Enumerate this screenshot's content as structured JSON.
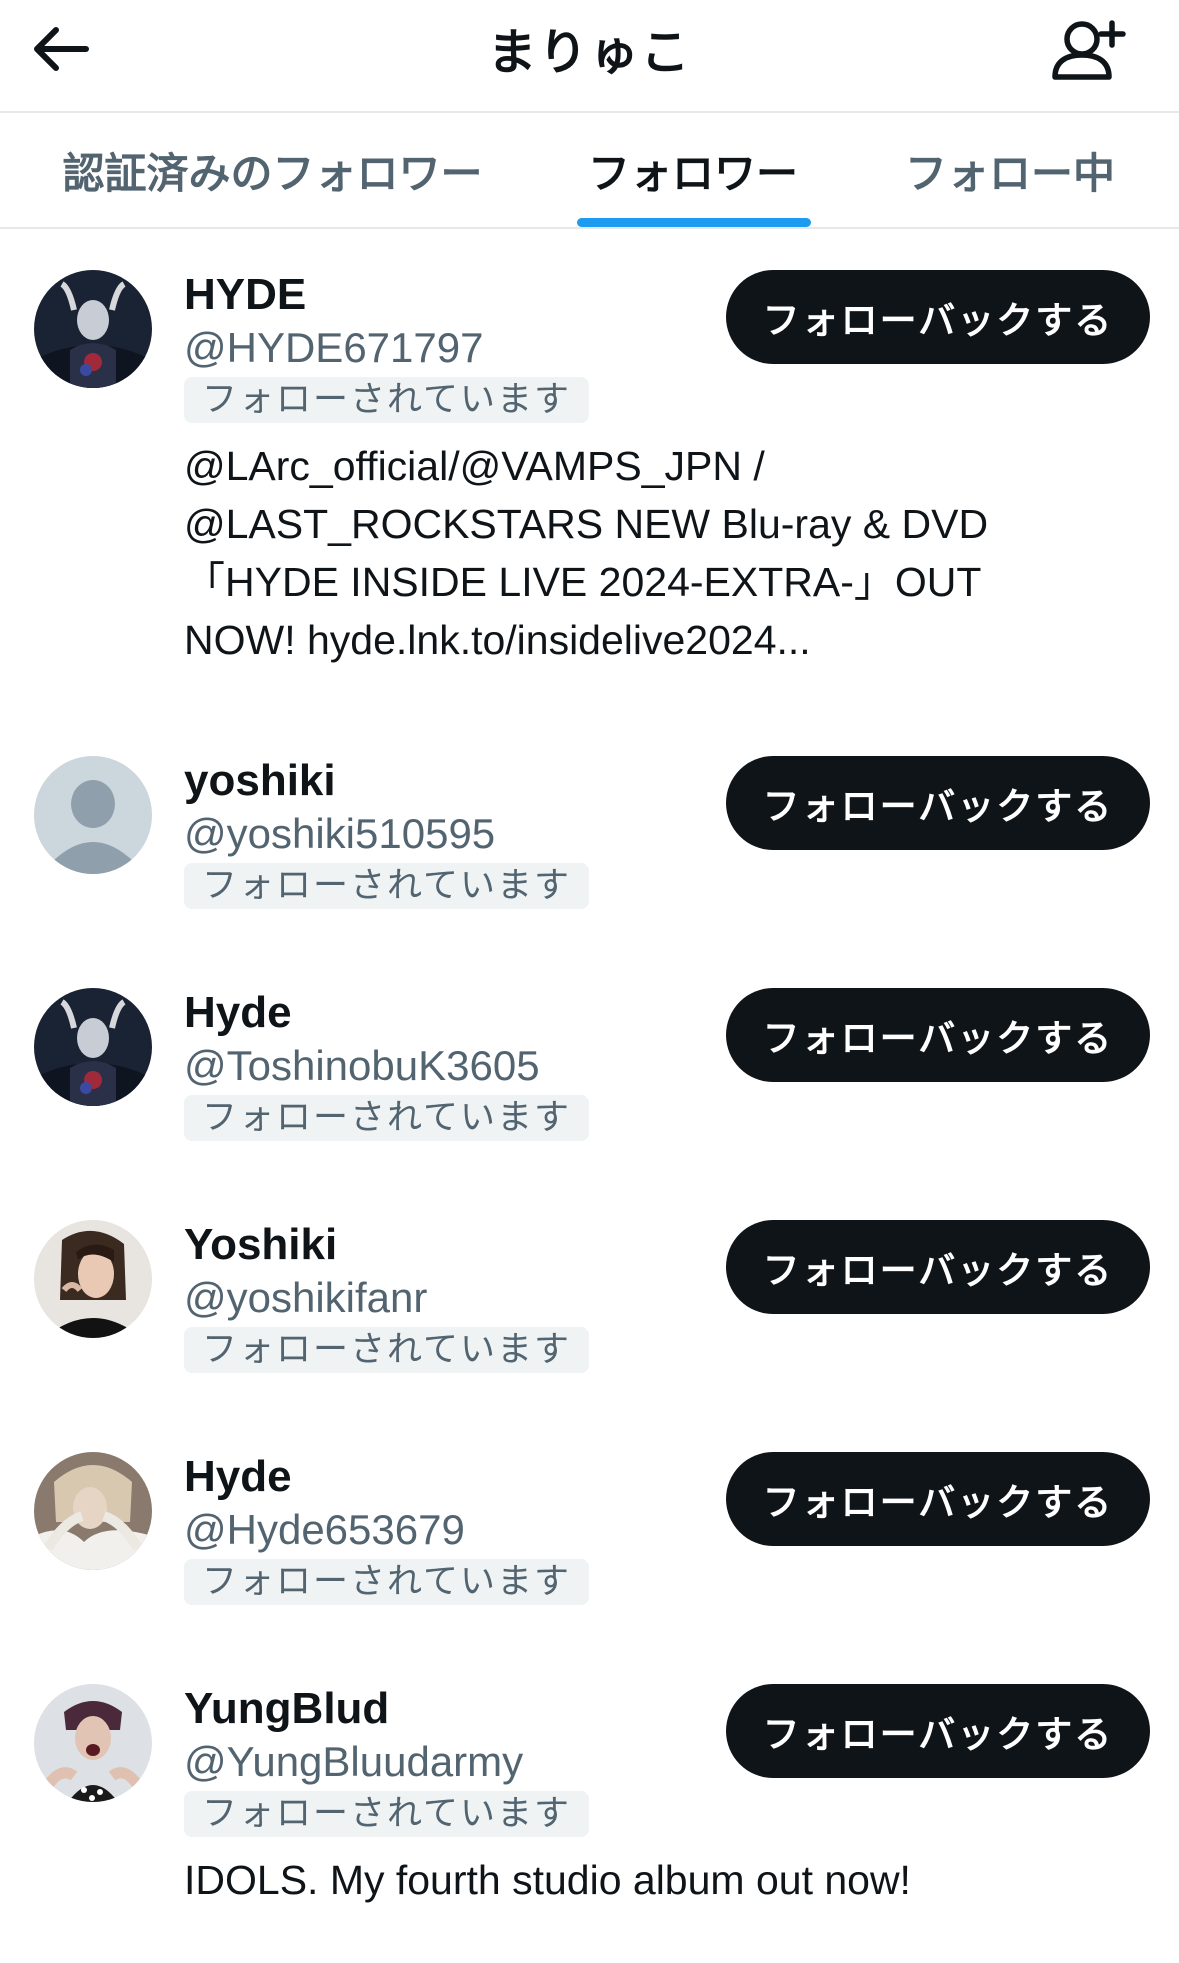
{
  "header": {
    "title": "まりゅこ",
    "back_icon": "arrow-left-icon",
    "add_user_icon": "add-user-icon"
  },
  "tabs": [
    {
      "label": "認証済みのフォロワー",
      "active": false
    },
    {
      "label": "フォロワー",
      "active": true
    },
    {
      "label": "フォロー中",
      "active": false
    }
  ],
  "colors": {
    "accent": "#1d9bf0",
    "button_bg": "#0f1419",
    "secondary_text": "#536471",
    "badge_bg": "#eff3f4"
  },
  "users": [
    {
      "name": "HYDE",
      "handle": "@HYDE671797",
      "badge": "フォローされています",
      "button": "フォローバックする",
      "bio": "@LArc_official/@VAMPS_JPN / @LAST_ROCKSTARS NEW Blu-ray & DVD「HYDE INSIDE LIVE 2024-EXTRA-」OUT NOW! hyde.lnk.to/insidelive2024...",
      "avatar": "hyde-photo"
    },
    {
      "name": "yoshiki",
      "handle": "@yoshiki510595",
      "badge": "フォローされています",
      "button": "フォローバックする",
      "bio": "",
      "avatar": "default-avatar"
    },
    {
      "name": "Hyde",
      "handle": "@ToshinobuK3605",
      "badge": "フォローされています",
      "button": "フォローバックする",
      "bio": "",
      "avatar": "hyde-photo"
    },
    {
      "name": "Yoshiki",
      "handle": "@yoshikifanr",
      "badge": "フォローされています",
      "button": "フォローバックする",
      "bio": "",
      "avatar": "yoshiki-photo"
    },
    {
      "name": "Hyde",
      "handle": "@Hyde653679",
      "badge": "フォローされています",
      "button": "フォローバックする",
      "bio": "",
      "avatar": "hyde-alt-photo"
    },
    {
      "name": "YungBlud",
      "handle": "@YungBluudarmy",
      "badge": "フォローされています",
      "button": "フォローバックする",
      "bio": "IDOLS. My fourth studio album out now!",
      "avatar": "yungblud-photo"
    }
  ]
}
